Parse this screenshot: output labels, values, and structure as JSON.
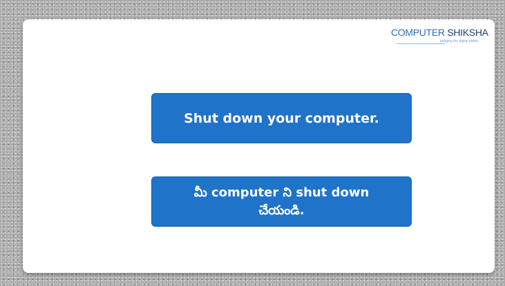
{
  "logo": {
    "word1": "COMPUTER",
    "word2": "SHIKSHA",
    "tagline": "bridging the digital divide"
  },
  "messages": {
    "english": "Shut down your computer.",
    "telugu": "మీ computer ని shut down చేయండి."
  },
  "colors": {
    "banner": "#1f73c9",
    "logo_primary": "#2f6fb7",
    "logo_secondary": "#1b3f73"
  }
}
